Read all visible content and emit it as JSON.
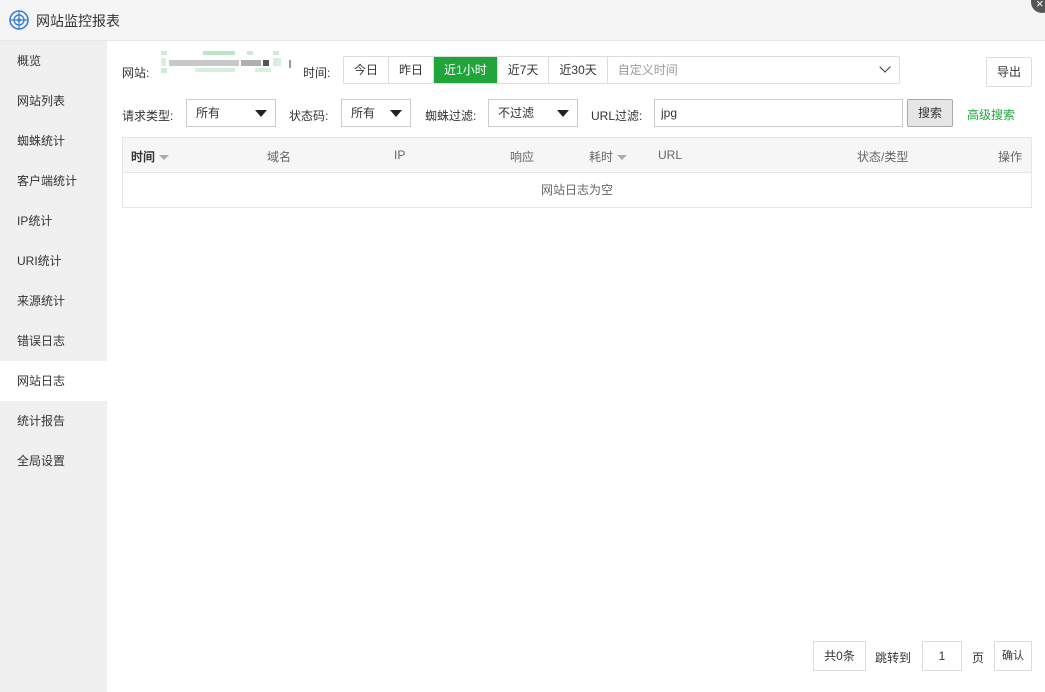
{
  "window": {
    "title": "网站监控报表",
    "close_glyph": "×"
  },
  "sidebar": {
    "items": [
      {
        "label": "概览"
      },
      {
        "label": "网站列表"
      },
      {
        "label": "蜘蛛统计"
      },
      {
        "label": "客户端统计"
      },
      {
        "label": "IP统计"
      },
      {
        "label": "URI统计"
      },
      {
        "label": "来源统计"
      },
      {
        "label": "错误日志"
      },
      {
        "label": "网站日志",
        "active": true
      },
      {
        "label": "统计报告"
      },
      {
        "label": "全局设置"
      }
    ]
  },
  "filters": {
    "site_label": "网站:",
    "time_label": "时间:",
    "time_options": [
      "今日",
      "昨日",
      "近1小时",
      "近7天",
      "近30天"
    ],
    "time_active": "近1小时",
    "custom_time_placeholder": "自定义时间",
    "export_label": "导出",
    "request_type_label": "请求类型:",
    "request_type_value": "所有",
    "status_code_label": "状态码:",
    "status_code_value": "所有",
    "spider_filter_label": "蜘蛛过滤:",
    "spider_filter_value": "不过滤",
    "url_filter_label": "URL过滤:",
    "url_filter_value": "jpg",
    "search_label": "搜索",
    "advanced_search_label": "高级搜索"
  },
  "table": {
    "columns": [
      "时间",
      "域名",
      "IP",
      "响应",
      "耗时",
      "URL",
      "状态/类型",
      "操作"
    ],
    "empty_text": "网站日志为空"
  },
  "pagination": {
    "total_label": "共0条",
    "jump_label": "跳转到",
    "page_value": "1",
    "page_unit": "页",
    "confirm_label": "确认"
  },
  "colors": {
    "accent": "#20a53a",
    "sidebar_bg": "#f0f0f0"
  }
}
